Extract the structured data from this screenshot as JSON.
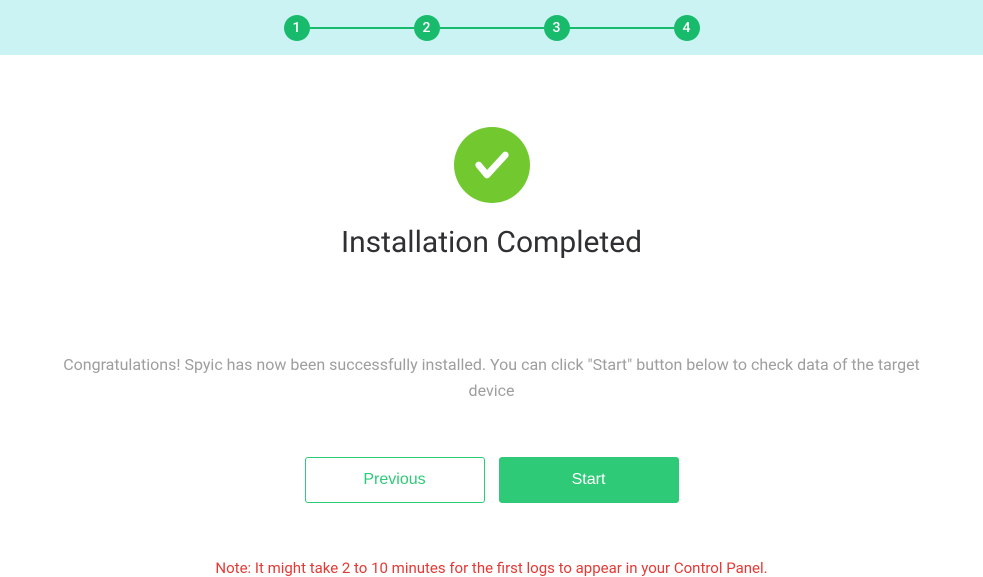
{
  "stepper": {
    "steps": [
      "1",
      "2",
      "3",
      "4"
    ]
  },
  "main": {
    "title": "Installation Completed",
    "description": "Congratulations! Spyic has now been successfully installed. You can click \"Start\" button below to check data of the target device",
    "previous_label": "Previous",
    "start_label": "Start",
    "note": "Note: It might take 2 to 10 minutes for the first logs to appear in your Control Panel."
  }
}
